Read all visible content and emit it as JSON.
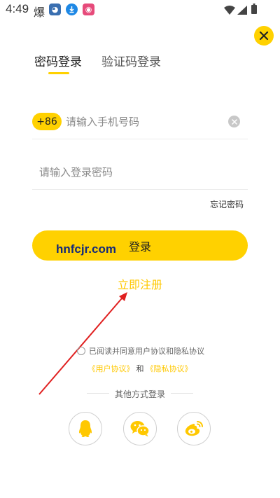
{
  "status_bar": {
    "time": "4:49",
    "flame_glyph": "爆",
    "icons": [
      "app-icon-1",
      "download-icon",
      "app-icon-2"
    ]
  },
  "tabs": [
    {
      "label": "密码登录",
      "active": true
    },
    {
      "label": "验证码登录",
      "active": false
    }
  ],
  "phone": {
    "country_code": "+86",
    "placeholder": "请输入手机号码",
    "value": ""
  },
  "password": {
    "placeholder": "请输入登录密码",
    "value": ""
  },
  "forgot_password": "忘记密码",
  "login_button": "登录",
  "watermark": "hnfcjr.com",
  "register_link": "立即注册",
  "agreement": {
    "text": "已阅读并同意用户协议和隐私协议",
    "user_agreement": "《用户协议》",
    "and": "和",
    "privacy_agreement": "《隐私协议》"
  },
  "other_login_label": "其他方式登录",
  "social": [
    "qq-icon",
    "wechat-icon",
    "weibo-icon"
  ],
  "colors": {
    "accent": "#FFD100",
    "link": "#FFC800",
    "annotation_arrow": "#e02020"
  }
}
